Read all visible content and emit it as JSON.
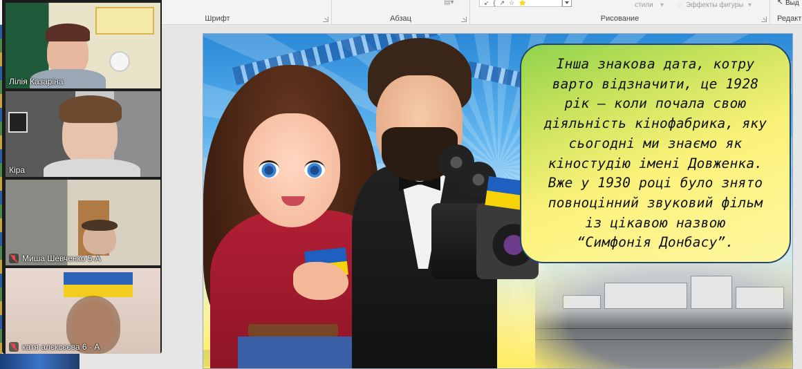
{
  "ribbon": {
    "groups": [
      {
        "label": "Шрифт"
      },
      {
        "label": "Абзац"
      },
      {
        "label": "Рисование"
      },
      {
        "label": "Редакти"
      }
    ],
    "styles_label": "стили",
    "shape_effects_label": "Эффекты фигуры",
    "select_label": "Выд"
  },
  "video_call": {
    "participants": [
      {
        "name": "Лілія Казаріна",
        "muted": false,
        "active": false
      },
      {
        "name": "Кіра",
        "muted": false,
        "active": true
      },
      {
        "name": "Миша Шевченко 5-А",
        "muted": true,
        "active": false
      },
      {
        "name": "катя алєксєєва 6 - А",
        "muted": true,
        "active": false
      }
    ]
  },
  "slide": {
    "text_lines": [
      "Інша знакова дата, котру",
      "варто відзначити, це 1928",
      "рік — коли почала свою",
      "діяльність кінофабрика, яку",
      "сьогодні ми знаємо як",
      "кіностудію імені Довженка.",
      "Вже у 1930 році було знято",
      "повноцінний звуковий фільм",
      "із цікавою назвою",
      "“Симфонія Донбасу”."
    ],
    "colors": {
      "bubble_border": "#23466e",
      "flag_blue": "#1f5fc0",
      "flag_yellow": "#f5d20a"
    }
  }
}
